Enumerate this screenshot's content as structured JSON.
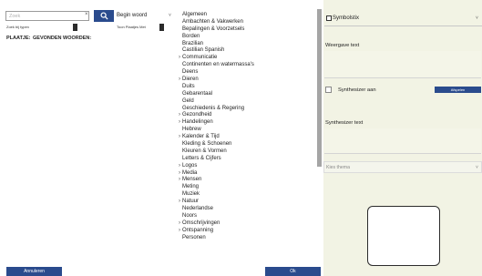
{
  "search": {
    "placeholder": "Zoek",
    "clear_glyph": "×",
    "button_icon": "search-icon"
  },
  "mode": {
    "selected": "Begin woord",
    "chevron": "˅"
  },
  "options": {
    "exact_label": "Zoek bij typen",
    "separator_label": "Toon Plaatjes Met"
  },
  "results": {
    "place_header": "PLAATJE:",
    "found_header": "GEVONDEN WOORDEN:"
  },
  "buttons": {
    "cancel": "Annuleren",
    "ok": "Ok",
    "play": "Afspelen"
  },
  "categories": [
    {
      "label": "Algemeen",
      "expandable": false
    },
    {
      "label": "Ambachten & Vakwerken",
      "expandable": false
    },
    {
      "label": "Bepalingen & Voorzetsels",
      "expandable": false
    },
    {
      "label": "Borden",
      "expandable": false
    },
    {
      "label": "Brazilian",
      "expandable": false
    },
    {
      "label": "Castilian Spanish",
      "expandable": false
    },
    {
      "label": "Communicatie",
      "expandable": true
    },
    {
      "label": "Continenten en watermassa's",
      "expandable": false
    },
    {
      "label": "Deens",
      "expandable": false
    },
    {
      "label": "Dieren",
      "expandable": true
    },
    {
      "label": "Duits",
      "expandable": false
    },
    {
      "label": "Gebarentaal",
      "expandable": false
    },
    {
      "label": "Geld",
      "expandable": false
    },
    {
      "label": "Geschiedenis & Regering",
      "expandable": false
    },
    {
      "label": "Gezondheid",
      "expandable": true
    },
    {
      "label": "Handelingen",
      "expandable": true
    },
    {
      "label": "Hebrew",
      "expandable": false
    },
    {
      "label": "Kalender & Tijd",
      "expandable": true
    },
    {
      "label": "Kleding & Schoenen",
      "expandable": false
    },
    {
      "label": "Kleuren & Vormen",
      "expandable": false
    },
    {
      "label": "Letters & Cijfers",
      "expandable": false
    },
    {
      "label": "Logos",
      "expandable": true
    },
    {
      "label": "Media",
      "expandable": true
    },
    {
      "label": "Mensen",
      "expandable": true
    },
    {
      "label": "Meting",
      "expandable": false
    },
    {
      "label": "Muziek",
      "expandable": false
    },
    {
      "label": "Natuur",
      "expandable": true
    },
    {
      "label": "Nederlandse",
      "expandable": false
    },
    {
      "label": "Noors",
      "expandable": false
    },
    {
      "label": "Omschrijvingen",
      "expandable": true
    },
    {
      "label": "Ontspanning",
      "expandable": true
    },
    {
      "label": "Personen",
      "expandable": false
    }
  ],
  "symbol": {
    "label": "Symbolstix",
    "icon": "symbolstix-icon",
    "chevron": "˅"
  },
  "display_text": {
    "label": "Weergave text",
    "value": ""
  },
  "synthesizer": {
    "label": "Synthesizer aan",
    "checked": false
  },
  "synthesizer_text": {
    "label": "Synthesizer text",
    "value": ""
  },
  "theme": {
    "placeholder": "Kies thema",
    "chevron": "˅"
  },
  "colors": {
    "accent": "#2a4b8d",
    "panel_bg": "#f2f3e4",
    "list_bg": "#ffffff"
  }
}
